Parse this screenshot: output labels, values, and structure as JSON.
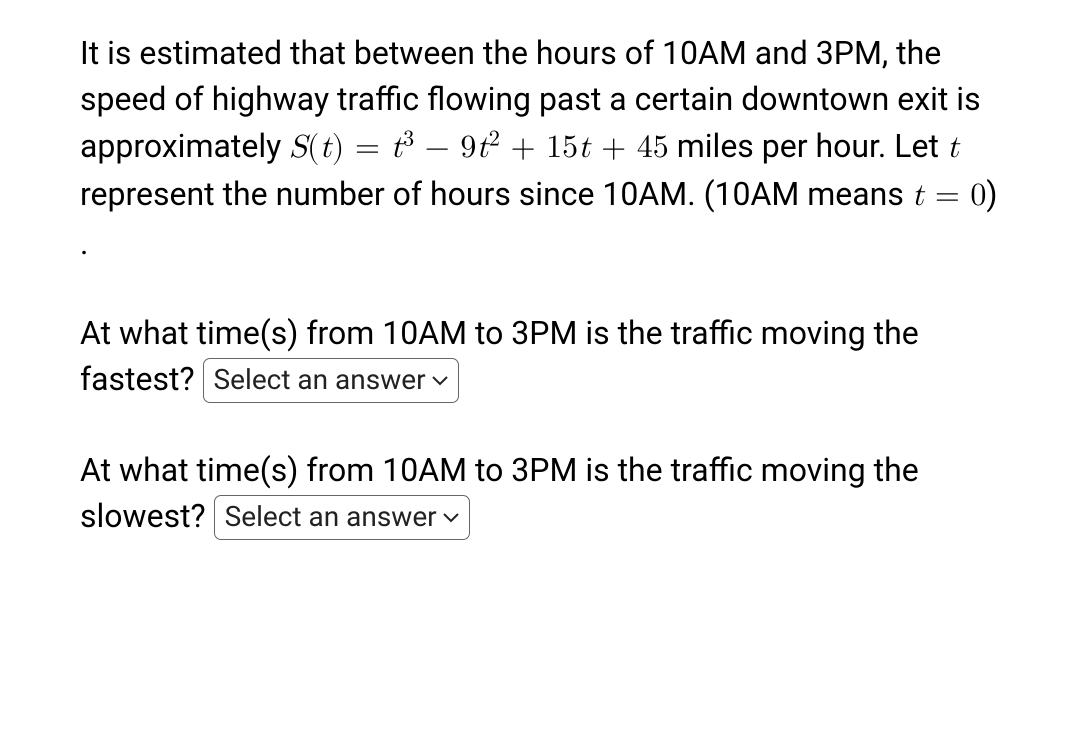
{
  "para1": {
    "t1": "It is estimated that between the hours of 10AM and 3PM, the speed of highway traffic flowing past a certain downtown exit is approximately ",
    "eq1_lhs": "S",
    "eq1_arg": "t",
    "eq1_eq": " = ",
    "eq1_t": "t",
    "eq1_p3": "3",
    "eq1_minus": " − 9",
    "eq1_p2": "2",
    "eq1_plus": " + 15",
    "eq1_tail": " + 45",
    "t2": " miles per hour. Let ",
    "var_t": "t",
    "t3": " represent the number of hours since 10AM. (10AM means ",
    "eq2": "t",
    "eq2_eq": " = 0",
    "t4": ") ."
  },
  "para2": {
    "t1": "At what time(s) from 10AM to 3PM is the traffic moving the fastest? ",
    "select": "Select an answer"
  },
  "para3": {
    "t1": "At what time(s) from 10AM to 3PM is the traffic moving the slowest? ",
    "select": "Select an answer"
  }
}
